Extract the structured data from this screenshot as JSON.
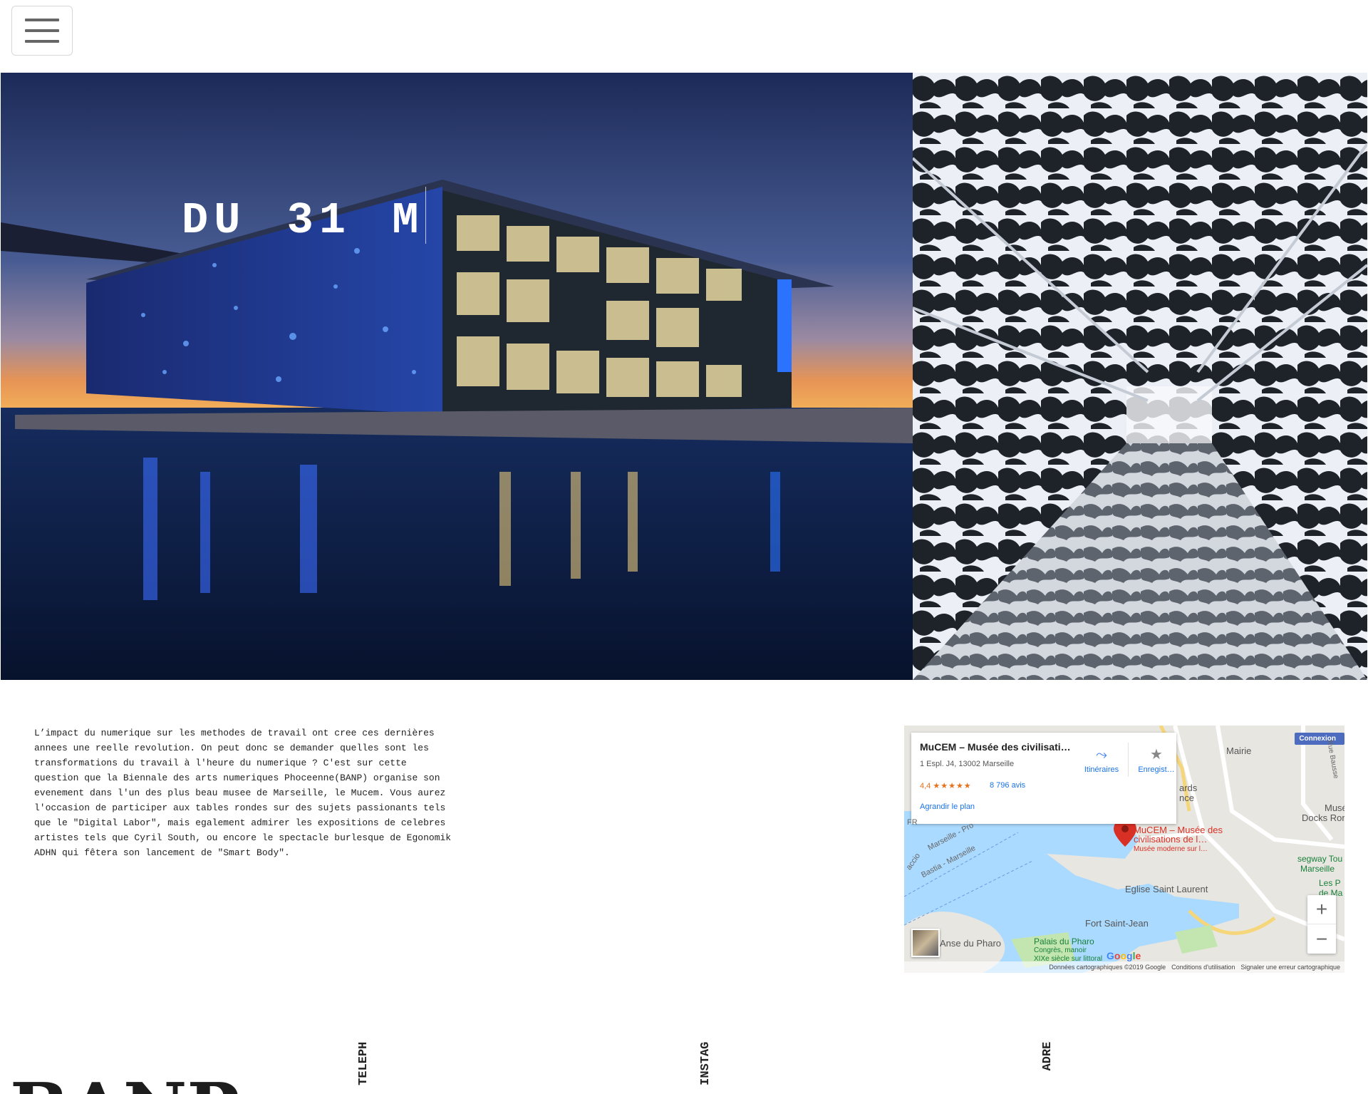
{
  "header": {
    "menu_icon": "hamburger-icon"
  },
  "hero": {
    "title": "DU 31 M",
    "left_image": "mucem-building-night",
    "right_image": "mucem-lattice-walkway"
  },
  "description": {
    "text": "L’impact du numerique sur les methodes de travail ont cree ces dernières annees une reelle revolution. On peut donc se demander quelles sont les transformations du travail à l'heure du numerique ? C'est sur cette question que la Biennale des arts numeriques Phoceenne(BANP) organise son evenement dans l'un des plus beau musee de Marseille, le Mucem. Vous aurez l'occasion de participer aux tables rondes sur des sujets passionants tels que le \"Digital Labor\", mais egalement admirer les expositions de celebres artistes tels que Cyril South, ou encore le spectacle burlesque de Egonomik ADHN qui fêtera son lancement de \"Smart Body\"."
  },
  "map": {
    "place_name": "MuCEM – Musée des civilisati…",
    "address": "1 Espl. J4, 13002 Marseille",
    "rating": "4,4",
    "stars": "★★★★★",
    "reviews": "8 796 avis",
    "enlarge": "Agrandir le plan",
    "directions": "Itinéraires",
    "save": "Enregist…",
    "connexion": "Connexion",
    "zoom_in": "+",
    "zoom_out": "−",
    "poi_name": "MuCEM – Musée des",
    "poi_name2": "civilisations de l…",
    "poi_sub": "Musée moderne sur l…",
    "labels": {
      "mairie": "Mairie",
      "eglise": "Eglise Saint Laurent",
      "fort": "Fort Saint-Jean",
      "pharo_anse": "Anse du Pharo",
      "pharo": "Palais du Pharo",
      "pharo_sub1": "Congrès, manoir",
      "pharo_sub2": "XIXe siècle sur littoral",
      "segway": "segway Tou",
      "segway2": "Marseille",
      "musee": "Musé",
      "docks": "Docks Ror",
      "lesp": "Les P",
      "dema": "de Ma",
      "ards": "ards",
      "nce": "nce",
      "ferry1": "Marseille - Pro",
      "ferry2": "Bastia - Marseille",
      "ferry3": "accio",
      "fr": "FR",
      "rue": "Rue Bausse"
    },
    "footer": {
      "data": "Données cartographiques ©2019 Google",
      "terms": "Conditions d'utilisation",
      "report": "Signaler une erreur cartographique"
    },
    "google": "Google"
  },
  "footer": {
    "brand": "BANP",
    "labels": [
      "TELEPHONE",
      "INSTAGRAM",
      "ADRESSE"
    ]
  }
}
